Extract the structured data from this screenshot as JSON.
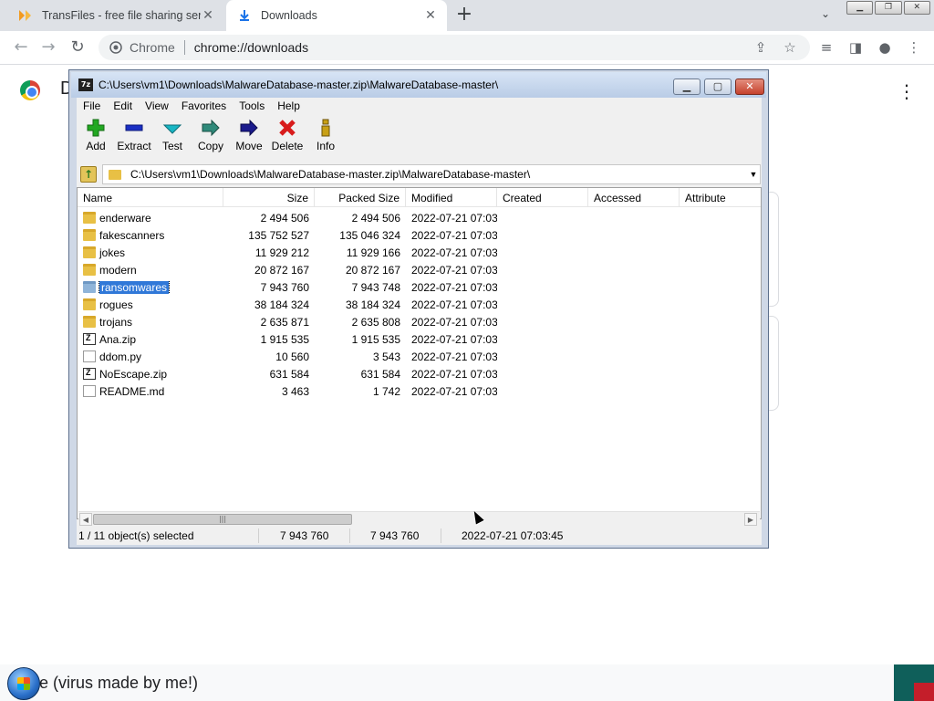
{
  "browser": {
    "tabs": [
      {
        "title": "TransFiles - free file sharing servi",
        "active": false
      },
      {
        "title": "Downloads",
        "active": true
      }
    ],
    "omnibox": {
      "chip": "Chrome",
      "url": "chrome://downloads"
    }
  },
  "page": {
    "title_stub": "D",
    "bottom_text": "xe (virus made by me!)"
  },
  "sevenzip": {
    "window_title": "C:\\Users\\vm1\\Downloads\\MalwareDatabase-master.zip\\MalwareDatabase-master\\",
    "app_icon": "7z",
    "menu": [
      "File",
      "Edit",
      "View",
      "Favorites",
      "Tools",
      "Help"
    ],
    "toolbar": [
      {
        "label": "Add",
        "icon": "plus-icon",
        "color": "#22a822"
      },
      {
        "label": "Extract",
        "icon": "minus-icon",
        "color": "#1a2fc4"
      },
      {
        "label": "Test",
        "icon": "check-icon",
        "color": "#19b6c4"
      },
      {
        "label": "Copy",
        "icon": "copy-arrow-icon",
        "color": "#2f8a7a"
      },
      {
        "label": "Move",
        "icon": "move-arrow-icon",
        "color": "#1a1a8c"
      },
      {
        "label": "Delete",
        "icon": "delete-x-icon",
        "color": "#d81c1c"
      },
      {
        "label": "Info",
        "icon": "info-icon",
        "color": "#c8a016"
      }
    ],
    "address": "C:\\Users\\vm1\\Downloads\\MalwareDatabase-master.zip\\MalwareDatabase-master\\",
    "columns": [
      "Name",
      "Size",
      "Packed Size",
      "Modified",
      "Created",
      "Accessed",
      "Attribute"
    ],
    "rows": [
      {
        "name": "enderware",
        "type": "folder",
        "size": "2 494 506",
        "packed": "2 494 506",
        "modified": "2022-07-21 07:03"
      },
      {
        "name": "fakescanners",
        "type": "folder",
        "size": "135 752 527",
        "packed": "135 046 324",
        "modified": "2022-07-21 07:03"
      },
      {
        "name": "jokes",
        "type": "folder",
        "size": "11 929 212",
        "packed": "11 929 166",
        "modified": "2022-07-21 07:03"
      },
      {
        "name": "modern",
        "type": "folder",
        "size": "20 872 167",
        "packed": "20 872 167",
        "modified": "2022-07-21 07:03"
      },
      {
        "name": "ransomwares",
        "type": "folder",
        "size": "7 943 760",
        "packed": "7 943 748",
        "modified": "2022-07-21 07:03",
        "selected": true
      },
      {
        "name": "rogues",
        "type": "folder",
        "size": "38 184 324",
        "packed": "38 184 324",
        "modified": "2022-07-21 07:03"
      },
      {
        "name": "trojans",
        "type": "folder",
        "size": "2 635 871",
        "packed": "2 635 808",
        "modified": "2022-07-21 07:03"
      },
      {
        "name": "Ana.zip",
        "type": "zip",
        "size": "1 915 535",
        "packed": "1 915 535",
        "modified": "2022-07-21 07:03"
      },
      {
        "name": "ddom.py",
        "type": "file",
        "size": "10 560",
        "packed": "3 543",
        "modified": "2022-07-21 07:03"
      },
      {
        "name": "NoEscape.zip",
        "type": "zip",
        "size": "631 584",
        "packed": "631 584",
        "modified": "2022-07-21 07:03"
      },
      {
        "name": "README.md",
        "type": "file",
        "size": "3 463",
        "packed": "1 742",
        "modified": "2022-07-21 07:03"
      }
    ],
    "status": {
      "selection": "1 / 11 object(s) selected",
      "size": "7 943 760",
      "packed": "7 943 760",
      "modified": "2022-07-21 07:03:45"
    }
  }
}
